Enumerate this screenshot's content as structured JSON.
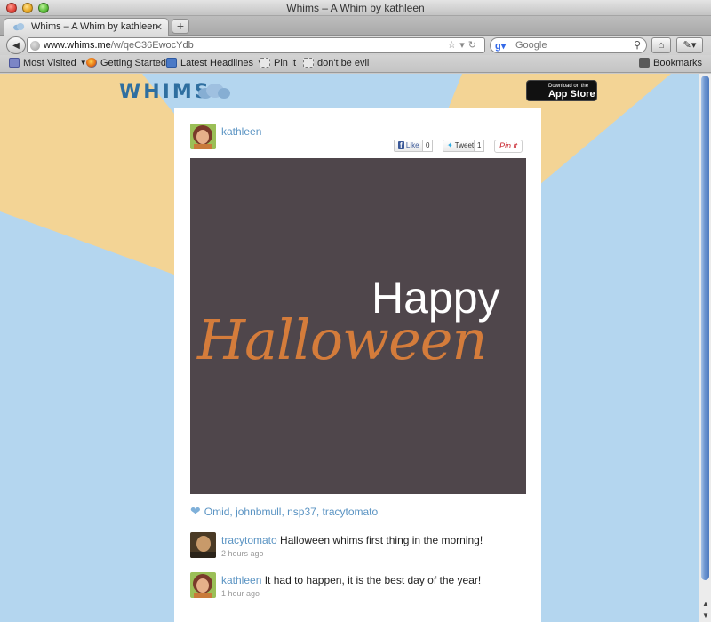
{
  "window": {
    "title": "Whims – A Whim by kathleen"
  },
  "tabs": [
    {
      "label": "Whims – A Whim by kathleen"
    }
  ],
  "nav": {
    "url_host": "www.whims.me",
    "url_path": "/w/qeC36EwocYdb",
    "search_placeholder": "Google"
  },
  "bookmarks": [
    {
      "label": "Most Visited",
      "icon": "most-visited-icon",
      "has_menu": true
    },
    {
      "label": "Getting Started",
      "icon": "firefox-icon",
      "has_menu": false
    },
    {
      "label": "Latest Headlines",
      "icon": "rss-icon",
      "has_menu": true
    },
    {
      "label": "Pin It",
      "icon": "page-icon",
      "has_menu": false
    },
    {
      "label": "don't be evil",
      "icon": "page-icon",
      "has_menu": false
    }
  ],
  "bookmarks_menu": "Bookmarks",
  "page": {
    "logo": "WHIMS",
    "appstore_small": "Download on the",
    "appstore_big": "App Store",
    "post": {
      "author": "kathleen",
      "fb_like": "Like",
      "fb_count": "0",
      "tweet": "Tweet",
      "tweet_count": "1",
      "pin": "Pin it",
      "whim_line1": "Happy",
      "whim_line2": "Halloween"
    },
    "likers": [
      "Omid",
      "johnbmull",
      "nsp37",
      "tracytomato"
    ],
    "comments": [
      {
        "name": "tracytomato",
        "text": "Halloween whims first thing in the morning!",
        "time": "2 hours ago"
      },
      {
        "name": "kathleen",
        "text": "It had to happen, it is the best day of the year!",
        "time": "1 hour ago"
      }
    ]
  },
  "colors": {
    "background": "#b4d6ef",
    "rays": "#f3d495",
    "whim_bg": "#4f464b",
    "halloween_text": "#d47c3b",
    "link": "#5b94c3"
  }
}
